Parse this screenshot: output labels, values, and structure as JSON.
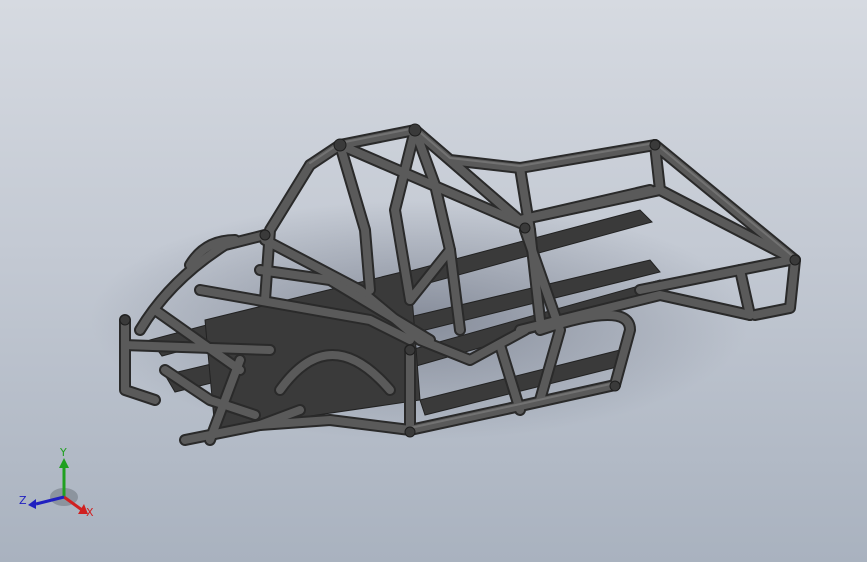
{
  "view": {
    "background_top": "#d6dae1",
    "background_bottom": "#a9b2bf",
    "tube_color": "#4a4a4a",
    "tube_highlight": "#7a7a7a",
    "shadow_color": "#5a6070"
  },
  "triad": {
    "x_label": "X",
    "y_label": "Y",
    "z_label": "Z",
    "x_color": "#d02020",
    "y_color": "#20a020",
    "z_color": "#2020c0"
  }
}
